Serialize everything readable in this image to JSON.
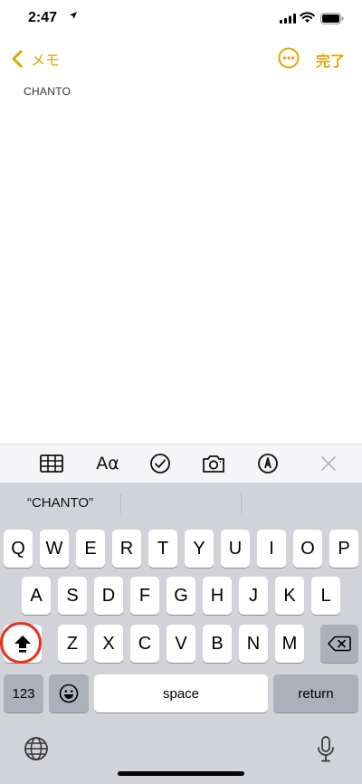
{
  "status_bar": {
    "time": "2:47"
  },
  "nav": {
    "back_label": "メモ",
    "done_label": "完了"
  },
  "note": {
    "text": "CHANTO"
  },
  "toolbar": {
    "format_label": "Aα"
  },
  "keyboard": {
    "suggestion": "“CHANTO”",
    "row1": [
      "Q",
      "W",
      "E",
      "R",
      "T",
      "Y",
      "U",
      "I",
      "O",
      "P"
    ],
    "row2": [
      "A",
      "S",
      "D",
      "F",
      "G",
      "H",
      "J",
      "K",
      "L"
    ],
    "row3": [
      "Z",
      "X",
      "C",
      "V",
      "B",
      "N",
      "M"
    ],
    "numbers_label": "123",
    "space_label": "space",
    "return_label": "return"
  },
  "colors": {
    "accent": "#e3a500",
    "highlight_ring": "#e8331c"
  },
  "icons": [
    "location-arrow-icon",
    "signal-icon",
    "wifi-icon",
    "battery-icon",
    "chevron-left-icon",
    "more-icon",
    "table-icon",
    "checklist-icon",
    "camera-icon",
    "markup-icon",
    "close-icon",
    "shift-icon",
    "delete-icon",
    "emoji-icon",
    "globe-icon",
    "mic-icon"
  ]
}
